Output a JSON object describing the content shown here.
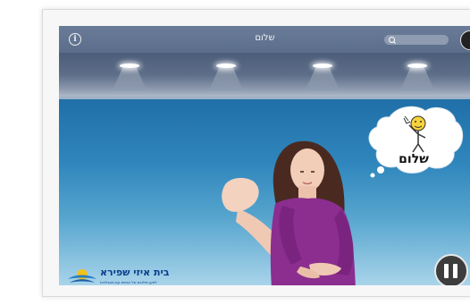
{
  "header": {
    "title": "שלום",
    "info_icon": "info-icon",
    "search_icon": "search-icon"
  },
  "bubble": {
    "word": "שלום",
    "symbol": "waving-smiley-icon"
  },
  "logo": {
    "name": "בית איזי שפירא",
    "tagline": "למען שילובם של אנשים עם מוגבלויות"
  },
  "controls": {
    "pause_icon": "pause-icon"
  },
  "colors": {
    "topbar": "#5c6f8c",
    "stage": "#2f86bc",
    "dress": "#8b2e8f",
    "logo": "#0b3f8a"
  }
}
